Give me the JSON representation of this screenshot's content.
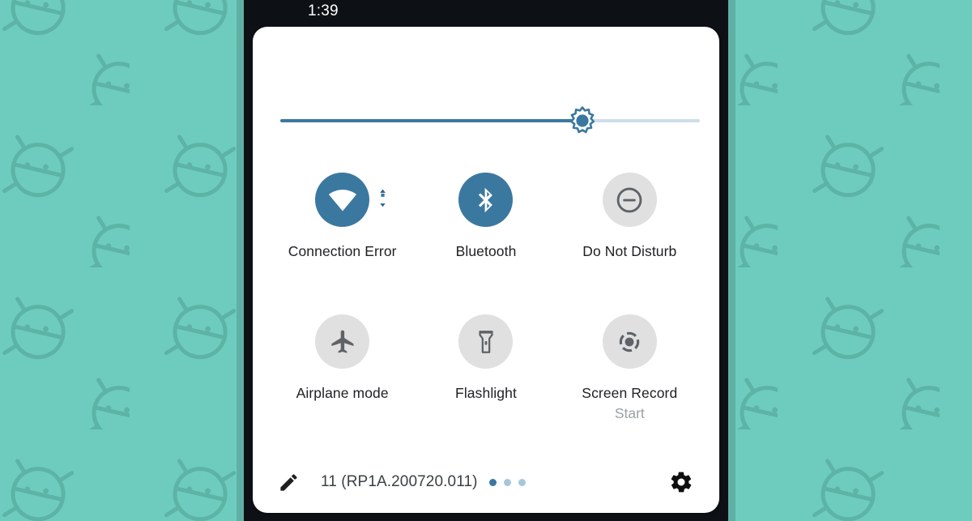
{
  "theme": {
    "wallpaper_color": "#6ECCBE",
    "wallpaper_pattern_color": "#5CB3A6",
    "phone_bezel_color": "#0d1014",
    "panel_background": "#ffffff",
    "accent_color": "#3B78A0",
    "tile_off_color": "#E0E0E0",
    "tile_off_icon_color": "#5f6368",
    "label_color": "#202124",
    "sublabel_color": "#9aa0a6"
  },
  "statusbar": {
    "clock": "1:39"
  },
  "brightness": {
    "name": "brightness-slider",
    "value_percent": 72,
    "thumb_icon": "brightness-sun-icon",
    "fill_color": "#3B78A0",
    "track_color": "#CDDEE9"
  },
  "tiles": [
    {
      "id": "wifi",
      "label": "Connection Error",
      "sublabel": "",
      "state": "on",
      "icon": "wifi-icon",
      "badge_icon": "data-activity-icon"
    },
    {
      "id": "bluetooth",
      "label": "Bluetooth",
      "sublabel": "",
      "state": "on",
      "icon": "bluetooth-icon",
      "badge_icon": ""
    },
    {
      "id": "dnd",
      "label": "Do Not Disturb",
      "sublabel": "",
      "state": "off",
      "icon": "do-not-disturb-icon",
      "badge_icon": ""
    },
    {
      "id": "airplane",
      "label": "Airplane mode",
      "sublabel": "",
      "state": "off",
      "icon": "airplane-icon",
      "badge_icon": ""
    },
    {
      "id": "flashlight",
      "label": "Flashlight",
      "sublabel": "",
      "state": "off",
      "icon": "flashlight-icon",
      "badge_icon": ""
    },
    {
      "id": "screen-record",
      "label": "Screen Record",
      "sublabel": "Start",
      "state": "off",
      "icon": "screen-record-icon",
      "badge_icon": ""
    }
  ],
  "footer": {
    "edit_icon": "pencil-edit-icon",
    "build_label": "11 (RP1A.200720.011)",
    "pages": {
      "count": 3,
      "active_index": 0
    },
    "settings_icon": "gear-icon"
  }
}
